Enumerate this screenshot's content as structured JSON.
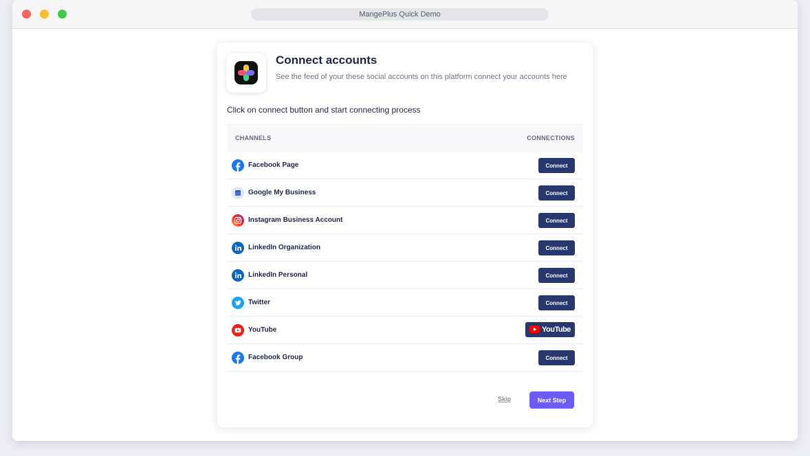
{
  "window": {
    "title": "MangePlus Quick Demo"
  },
  "header": {
    "title": "Connect accounts",
    "subtitle": "See the feed of your these social accounts on this platform connect your accounts here",
    "logo_icon": "mangeplus-logo"
  },
  "instruction": "Click on connect button and start connecting process",
  "table": {
    "columns": [
      "CHANNELS",
      "CONNECTIONS"
    ],
    "rows": [
      {
        "icon": "facebook-icon",
        "label": "Facebook Page",
        "action": "Connect"
      },
      {
        "icon": "google-my-business-icon",
        "label": "Google My Business",
        "action": "Connect"
      },
      {
        "icon": "instagram-icon",
        "label": "Instagram Business Account",
        "action": "Connect"
      },
      {
        "icon": "linkedin-icon",
        "label": "LinkedIn Organization",
        "action": "Connect"
      },
      {
        "icon": "linkedin-icon",
        "label": "LinkedIn Personal",
        "action": "Connect"
      },
      {
        "icon": "twitter-icon",
        "label": "Twitter",
        "action": "Connect"
      },
      {
        "icon": "youtube-icon",
        "label": "YouTube",
        "action": "YouTube"
      },
      {
        "icon": "facebook-icon",
        "label": "Facebook Group",
        "action": "Connect"
      }
    ]
  },
  "footer": {
    "skip_label": "Skip",
    "next_label": "Next Step"
  },
  "colors": {
    "primary_button": "#28386e",
    "accent_button": "#6c5cf6",
    "text_dark": "#1e2540"
  }
}
